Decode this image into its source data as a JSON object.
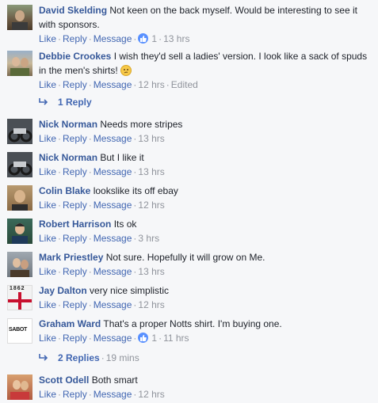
{
  "actions": {
    "like": "Like",
    "reply": "Reply",
    "message": "Message",
    "dot": "·"
  },
  "comments": [
    {
      "author": "David Skelding",
      "text": "Not keen on the back myself. Would be interesting to see it",
      "text2": "with sponsors.",
      "likes": "1",
      "time": "13 hrs",
      "edited": ""
    },
    {
      "author": "Debbie Crookes",
      "text": "I wish they'd sell a ladies' version. I look like a sack of spuds",
      "text2": "in the men's shirts!",
      "time": "12 hrs",
      "edited": "Edited"
    },
    {
      "author": "Nick Norman",
      "text": "Needs more stripes",
      "time": "13 hrs"
    },
    {
      "author": "Nick Norman",
      "text": "But I like it",
      "time": "13 hrs"
    },
    {
      "author": "Colin Blake",
      "text": "lookslike its off ebay",
      "time": "12 hrs"
    },
    {
      "author": "Robert Harrison",
      "text": "Its ok",
      "time": "3 hrs"
    },
    {
      "author": "Mark Priestley",
      "text": "Not sure. Hopefully it will grow on Me.",
      "time": "13 hrs"
    },
    {
      "author": "Jay Dalton",
      "text": "very nice simplistic",
      "time": "12 hrs"
    },
    {
      "author": "Graham Ward",
      "text": "That's a proper Notts shirt. I'm buying one.",
      "likes": "1",
      "time": "11 hrs"
    },
    {
      "author": "Scott Odell",
      "text": "Both smart",
      "time": "12 hrs"
    }
  ],
  "replies": [
    {
      "label": "1 Reply",
      "time": ""
    },
    {
      "label": "2 Replies",
      "time": "19 mins"
    }
  ],
  "avatar_texts": {
    "jay": "1862",
    "graham": "SABOT"
  },
  "colors": {
    "link": "#365899",
    "action": "#4267b2",
    "meta": "#90949c",
    "like": "#5890ff"
  }
}
